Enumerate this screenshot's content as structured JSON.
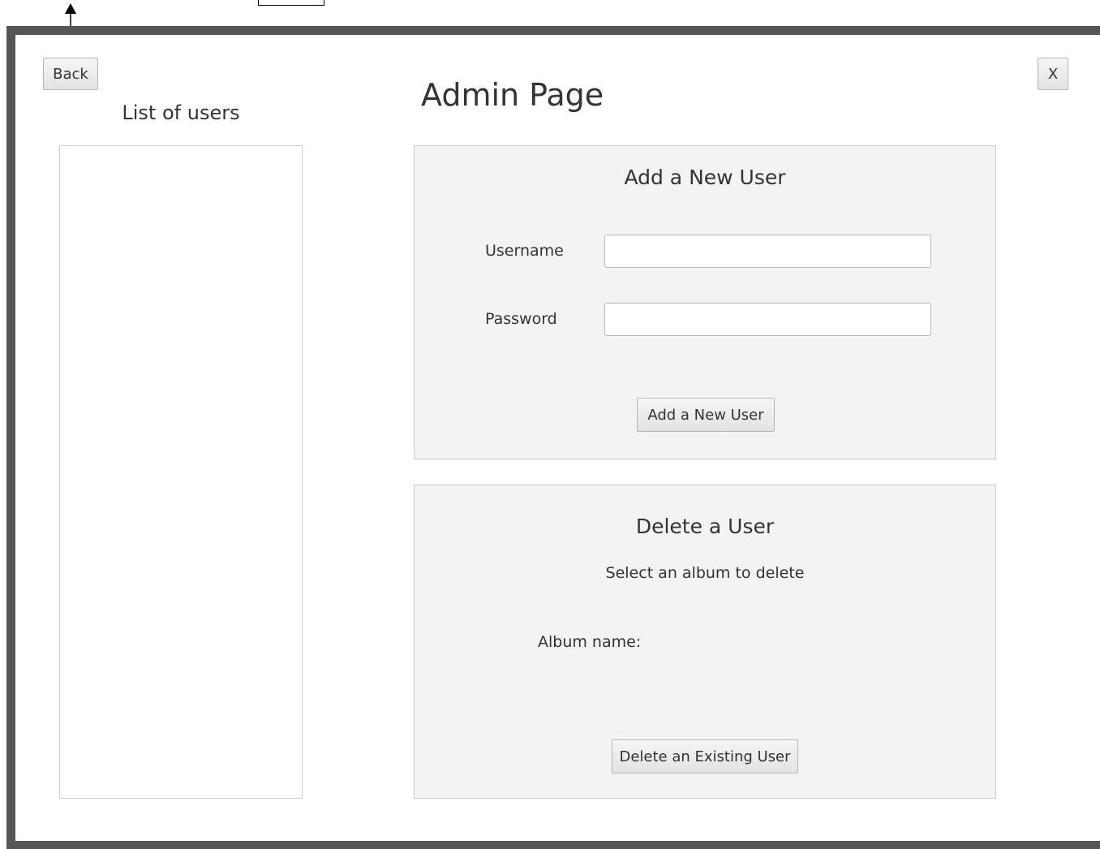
{
  "window": {
    "back_label": "Back",
    "close_label": "X",
    "title": "Admin Page"
  },
  "user_list": {
    "title": "List of users",
    "items": []
  },
  "add_user": {
    "title": "Add a New User",
    "username_label": "Username",
    "username_value": "",
    "password_label": "Password",
    "password_value": "",
    "button_label": "Add a New User"
  },
  "delete_user": {
    "title": "Delete a User",
    "subtitle": "Select an album to delete",
    "album_label": "Album name:",
    "button_label": "Delete an Existing User"
  },
  "colors": {
    "frame": "#555555",
    "panel": "#f3f3f3",
    "text": "#333333"
  }
}
